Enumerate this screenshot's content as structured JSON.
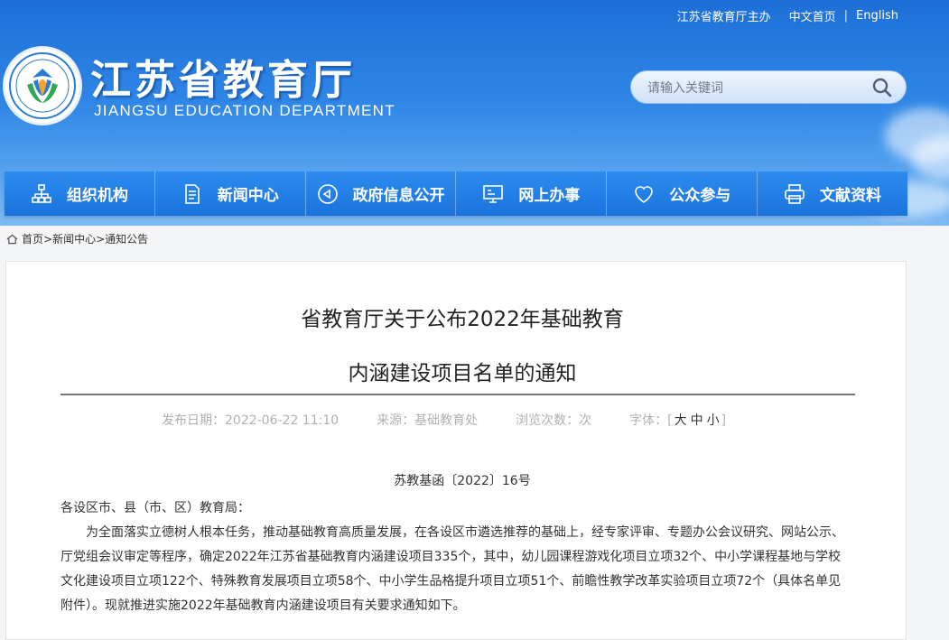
{
  "top_links": {
    "sponsor": "江苏省教育厅主办",
    "chinese": "中文首页",
    "english": "English"
  },
  "logo": {
    "title": "江苏省教育厅",
    "subtitle": "JIANGSU EDUCATION DEPARTMENT"
  },
  "search": {
    "placeholder": "请输入关键词"
  },
  "nav": [
    {
      "label": "组织机构",
      "icon": "org-chart-icon"
    },
    {
      "label": "新闻中心",
      "icon": "news-document-icon"
    },
    {
      "label": "政府信息公开",
      "icon": "announcement-icon"
    },
    {
      "label": "网上办事",
      "icon": "monitor-icon"
    },
    {
      "label": "公众参与",
      "icon": "heart-icon"
    },
    {
      "label": "文献资料",
      "icon": "printer-icon"
    }
  ],
  "breadcrumb": {
    "home": "首页",
    "sep1": ">",
    "news": "新闻中心",
    "sep2": ">",
    "notice": "通知公告"
  },
  "article": {
    "title_line1": "省教育厅关于公布2022年基础教育",
    "title_line2": "内涵建设项目名单的通知",
    "meta": {
      "date": "发布日期：2022-06-22 11:10",
      "source": "来源：基础教育处",
      "views": "浏览次数：次",
      "font_label": "字体：[",
      "font_large": "大",
      "font_medium": "中",
      "font_small": "小",
      "font_end": "]"
    },
    "doc_no": "苏教基函〔2022〕16号",
    "salutation": "各设区市、县（市、区）教育局：",
    "paragraph1": "为全面落实立德树人根本任务，推动基础教育高质量发展，在各设区市遴选推荐的基础上，经专家评审、专题办公会议研究、网站公示、厅党组会议审定等程序，确定2022年江苏省基础教育内涵建设项目335个，其中，幼儿园课程游戏化项目立项32个、中小学课程基地与学校文化建设项目立项122个、特殊教育发展项目立项58个、中小学生品格提升项目立项51个、前瞻性教学改革实验项目立项72个（具体名单见附件）。现就推进实施2022年基础教育内涵建设项目有关要求通知如下。"
  },
  "colors": {
    "header_blue": "#2f86e6",
    "nav_blue": "#1a73dc",
    "rule": "#777777"
  }
}
